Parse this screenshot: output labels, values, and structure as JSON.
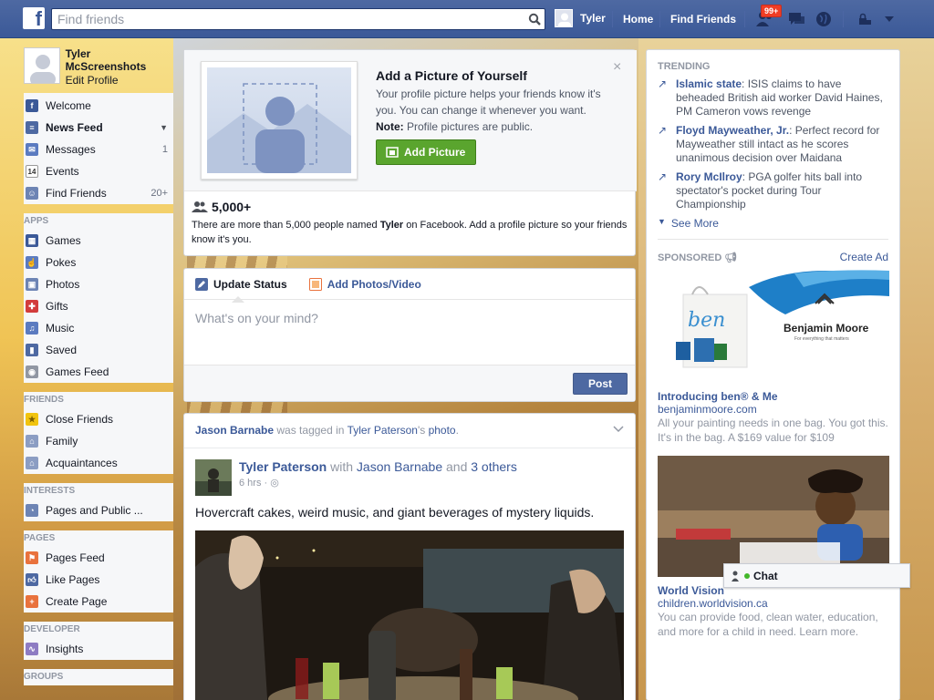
{
  "topbar": {
    "logo": "f",
    "search_placeholder": "Find friends",
    "user_name": "Tyler",
    "home": "Home",
    "find_friends": "Find Friends",
    "friend_requests_badge": "99+"
  },
  "profile": {
    "name": "Tyler McScreenshots",
    "edit": "Edit Profile"
  },
  "sidebar": {
    "main": [
      {
        "label": "Welcome",
        "icon": "facebook-icon",
        "count": ""
      },
      {
        "label": "News Feed",
        "icon": "news-feed-icon",
        "count": ""
      },
      {
        "label": "Messages",
        "icon": "messages-icon",
        "count": "1"
      },
      {
        "label": "Events",
        "icon": "calendar-icon",
        "count": ""
      },
      {
        "label": "Find Friends",
        "icon": "find-friends-icon",
        "count": "20+"
      }
    ],
    "apps_header": "APPS",
    "apps": [
      {
        "label": "Games",
        "icon": "games-icon"
      },
      {
        "label": "Pokes",
        "icon": "pokes-icon"
      },
      {
        "label": "Photos",
        "icon": "photos-icon"
      },
      {
        "label": "Gifts",
        "icon": "gifts-icon"
      },
      {
        "label": "Music",
        "icon": "music-icon"
      },
      {
        "label": "Saved",
        "icon": "saved-icon"
      },
      {
        "label": "Games Feed",
        "icon": "games-feed-icon"
      }
    ],
    "friends_header": "FRIENDS",
    "friends": [
      {
        "label": "Close Friends",
        "icon": "star-icon"
      },
      {
        "label": "Family",
        "icon": "family-icon"
      },
      {
        "label": "Acquaintances",
        "icon": "acquaintances-icon"
      }
    ],
    "interests_header": "INTERESTS",
    "interests": [
      {
        "label": "Pages and Public ...",
        "icon": "rss-icon"
      }
    ],
    "pages_header": "PAGES",
    "pages": [
      {
        "label": "Pages Feed",
        "icon": "pages-feed-icon"
      },
      {
        "label": "Like Pages",
        "icon": "thumbs-up-icon"
      },
      {
        "label": "Create Page",
        "icon": "plus-icon"
      }
    ],
    "developer_header": "DEVELOPER",
    "developer": [
      {
        "label": "Insights",
        "icon": "insights-icon"
      }
    ],
    "groups_header": "GROUPS"
  },
  "picture_prompt": {
    "title": "Add a Picture of Yourself",
    "desc": "Your profile picture helps your friends know it's you. You can change it whenever you want.",
    "note_label": "Note:",
    "note_text": " Profile pictures are public.",
    "button": "Add Picture",
    "close": "×",
    "count": "5,000+",
    "stats_pre": "There are more than 5,000 people named ",
    "stats_name": "Tyler",
    "stats_post": " on Facebook. Add a profile picture so your friends know it's you."
  },
  "composer": {
    "tab_status": "Update Status",
    "tab_photos": "Add Photos/Video",
    "placeholder": "What's on your mind?",
    "post_button": "Post"
  },
  "story": {
    "header_actor": "Jason Barnabe",
    "header_mid": " was tagged in ",
    "header_owner": "Tyler Paterson",
    "header_owner_suffix": "'s ",
    "header_object": "photo",
    "header_end": ".",
    "author": "Tyler Paterson",
    "with_word": " with ",
    "tagged": "Jason Barnabe",
    "and_word": " and ",
    "others": "3 others",
    "time": "6 hrs",
    "text": "Hovercraft cakes, weird music, and giant beverages of mystery liquids."
  },
  "trending": {
    "header": "TRENDING",
    "items": [
      {
        "topic": "Islamic state",
        "text": ": ISIS claims to have beheaded British aid worker David Haines, PM Cameron vows revenge"
      },
      {
        "topic": "Floyd Mayweather, Jr.",
        "text": ": Perfect record for Mayweather still intact as he scores unanimous decision over Maidana"
      },
      {
        "topic": "Rory McIlroy",
        "text": ": PGA golfer hits ball into spectator's pocket during Tour Championship"
      }
    ],
    "see_more": "See More"
  },
  "sponsored": {
    "header": "SPONSORED",
    "create_ad": "Create Ad",
    "ads": [
      {
        "brand_text": "Benjamin Moore",
        "brand_tagline": "For everything that matters",
        "bag_text": "ben",
        "title": "Introducing ben® & Me",
        "url": "benjaminmoore.com",
        "desc": "All your painting needs in one bag. You got this. It's in the bag. A $169 value for $109"
      },
      {
        "title": "World Vision",
        "url": "children.worldvision.ca",
        "desc": "You can provide food, clean water, education, and more for a child in need. Learn more."
      }
    ]
  },
  "chat": {
    "label": "Chat"
  }
}
